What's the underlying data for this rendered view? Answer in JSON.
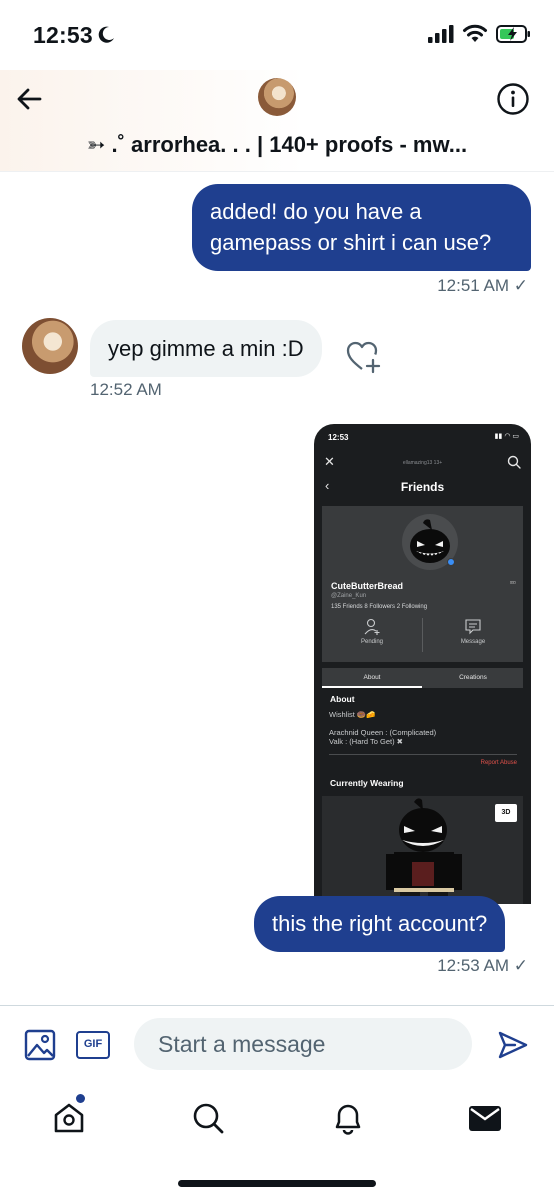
{
  "status_bar": {
    "time": "12:53"
  },
  "header": {
    "title": "➳ .˚ arrorhea. . . | 140+ proofs - mw..."
  },
  "messages": [
    {
      "direction": "out",
      "text": "added! do you have a gamepass or shirt i can use?",
      "time": "12:51 AM ✓"
    },
    {
      "direction": "in",
      "text": "yep gimme a min :D",
      "time": "12:52 AM"
    },
    {
      "direction": "out",
      "text": "this the right account?",
      "time": "12:53 AM ✓"
    }
  ],
  "attachment": {
    "status_time": "12:53",
    "top_username": "ellamazing13 13+",
    "page_title": "Friends",
    "display_name": "CuteButterBread",
    "handle": "@Zaine_Kun",
    "stats": "135 Friends   8 Followers   2 Following",
    "action_pending": "Pending",
    "action_message": "Message",
    "tab_about": "About",
    "tab_creations": "Creations",
    "about_heading": "About",
    "about_line1": "Wishlist 🍩🧀",
    "about_line2": "Arachnid Queen : (Complicated)",
    "about_line3": "Valk : (Hard To Get) ✖",
    "report_abuse": "Report Abuse",
    "currently_wearing": "Currently Wearing",
    "badge_3d": "3D"
  },
  "composer": {
    "placeholder": "Start a message",
    "gif_label": "GIF"
  },
  "colors": {
    "accent": "#1f3f8f",
    "bubble_in": "#eff3f4",
    "timestamp": "#536471",
    "report": "#e0514a"
  },
  "icons": [
    "back-arrow-icon",
    "info-icon",
    "heart-add-icon",
    "image-icon",
    "gif-icon",
    "send-icon",
    "home-icon",
    "search-icon",
    "bell-icon",
    "mail-icon"
  ]
}
